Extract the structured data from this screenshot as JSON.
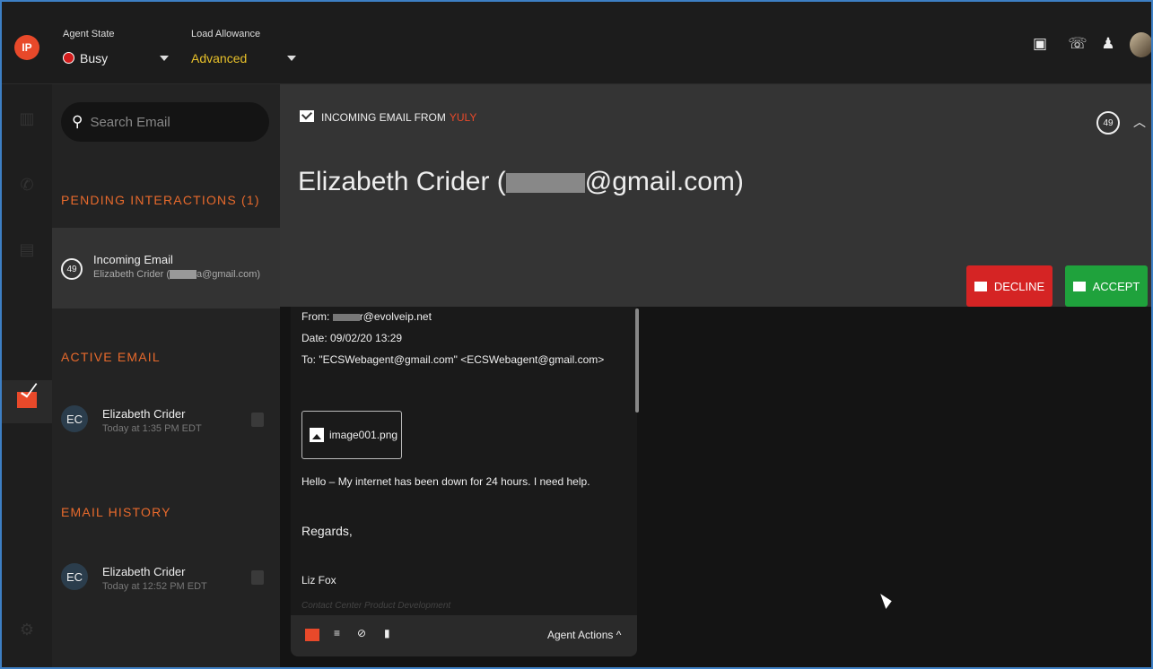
{
  "topbar": {
    "logo": "IP",
    "agent_state_label": "Agent State",
    "agent_state_value": "Busy",
    "load_allowance_label": "Load Allowance",
    "load_allowance_value": "Advanced",
    "icons": [
      "phone-device-icon",
      "phone-transfer-icon",
      "bell-icon",
      "user-avatar"
    ]
  },
  "rail": {
    "icons": [
      "chart-icon",
      "phone-icon",
      "chat-icon",
      "email-icon",
      "settings-icon"
    ]
  },
  "list": {
    "search_placeholder": "Search Email",
    "pending_header": "PENDING INTERACTIONS (1)",
    "pending_item": {
      "timer": "49",
      "title": "Incoming Email",
      "subtitle_prefix": "Elizabeth Crider (",
      "subtitle_suffix": "a@gmail.com)"
    },
    "active_header": "ACTIVE EMAIL",
    "active_item": {
      "initials": "EC",
      "name": "Elizabeth Crider",
      "time": "Today at 1:35 PM EDT"
    },
    "history_header": "EMAIL HISTORY",
    "history_item": {
      "initials": "EC",
      "name": "Elizabeth Crider",
      "time": "Today at 12:52 PM EDT"
    }
  },
  "banner": {
    "incoming_label": "INCOMING EMAIL FROM",
    "incoming_from": "YULY",
    "contact_name_prefix": "Elizabeth Crider (",
    "contact_name_suffix": "@gmail.com)",
    "timer": "49",
    "decline_label": "DECLINE",
    "accept_label": "ACCEPT",
    "colors": {
      "decline": "#d52424",
      "accept": "#1fa23c",
      "accent": "#e8492a"
    }
  },
  "email": {
    "from_label": "From:",
    "from_value": "r@evolveip.net",
    "date_line": "Date: 09/02/20 13:29",
    "to_line": "To: \"ECSWebagent@gmail.com\" <ECSWebagent@gmail.com>",
    "attachment_name": "image001.png",
    "body": "Hello – My internet has been down for 24 hours.  I need help.",
    "regards": "Regards,",
    "signature_name": "Liz Fox",
    "signature_title": "Contact Center Product Development",
    "footer_actions_label": "Agent Actions ^"
  }
}
